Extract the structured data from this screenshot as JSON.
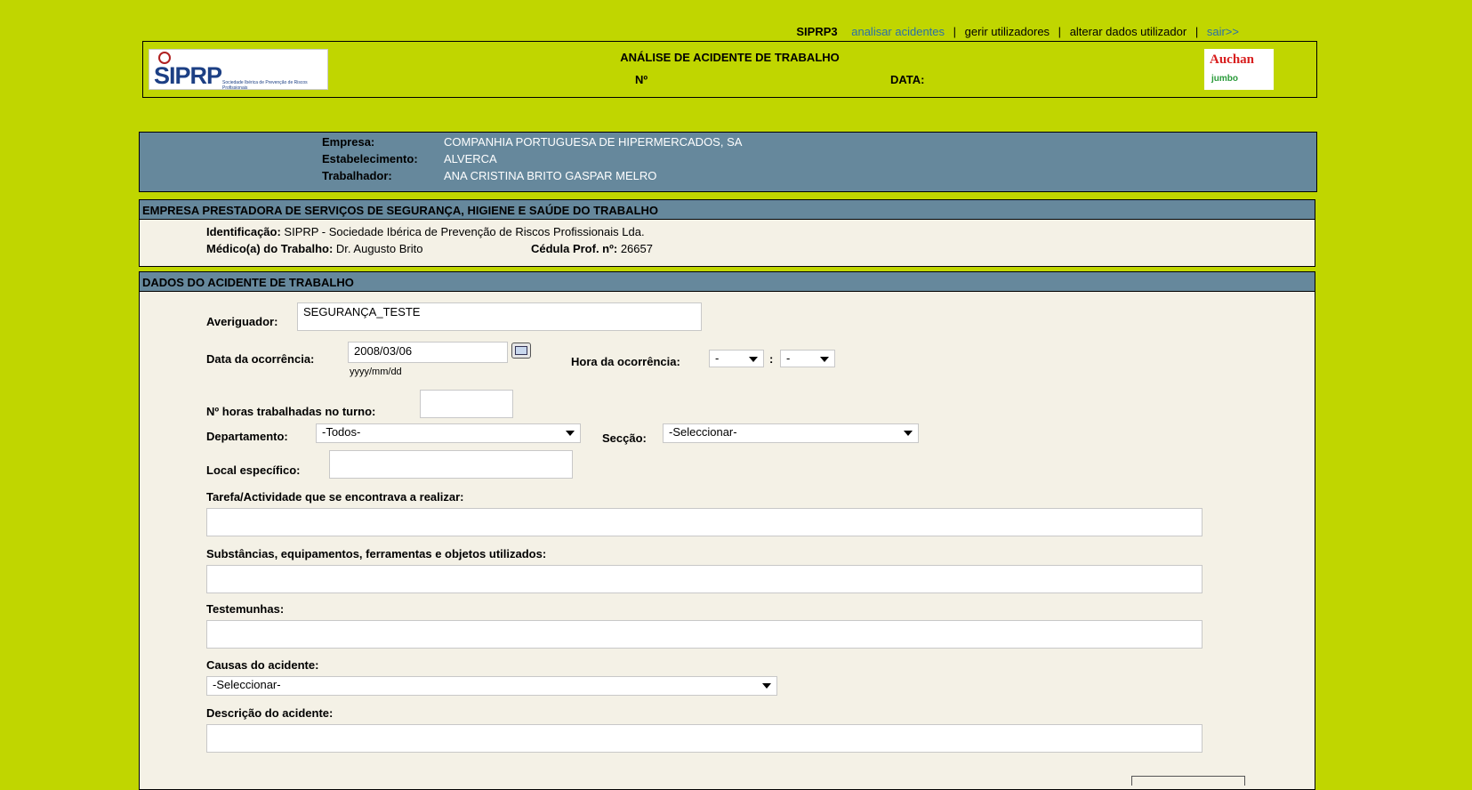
{
  "topnav": {
    "app": "SIPRP3",
    "analisar": "analisar acidentes",
    "sep": "|",
    "gerir": "gerir utilizadores",
    "alterar": "alterar dados utilizador",
    "sair": "sair>>"
  },
  "header": {
    "logo_text": "SIPRP",
    "logo_subtitle": "Sociedade Ibérica de Prevenção de Riscos Profissionais",
    "title": "ANÁLISE DE ACIDENTE DE TRABALHO",
    "n_label": "Nº",
    "data_label": "DATA:",
    "client_logo_top": "Auchan",
    "client_logo_bottom": "jumbo"
  },
  "info": {
    "empresa_label": "Empresa:",
    "empresa_value": "COMPANHIA PORTUGUESA DE HIPERMERCADOS, SA",
    "estabelecimento_label": "Estabelecimento:",
    "estabelecimento_value": "ALVERCA",
    "trabalhador_label": "Trabalhador:",
    "trabalhador_value": "ANA CRISTINA BRITO GASPAR MELRO"
  },
  "prestadora": {
    "title": "EMPRESA PRESTADORA DE SERVIÇOS DE SEGURANÇA, HIGIENE E SAÚDE DO TRABALHO",
    "identificacao_label": "Identificação:",
    "identificacao_value": "SIPRP - Sociedade Ibérica de Prevenção de Riscos Profissionais Lda.",
    "medico_label": "Médico(a) do Trabalho:",
    "medico_value": "Dr. Augusto Brito",
    "cedula_label": "Cédula Prof. nº:",
    "cedula_value": "26657"
  },
  "acidente": {
    "title": "DADOS DO ACIDENTE DE TRABALHO",
    "averiguador_label": "Averiguador:",
    "averiguador_value": "SEGURANÇA_TESTE",
    "data_label": "Data da ocorrência:",
    "data_value": "2008/03/06",
    "data_hint": "yyyy/mm/dd",
    "hora_label": "Hora da ocorrência:",
    "hora_value": "-",
    "hora_sep": ":",
    "minuto_value": "-",
    "horas_turno_label": "Nº horas trabalhadas no turno:",
    "horas_turno_value": "",
    "departamento_label": "Departamento:",
    "departamento_value": "-Todos-",
    "seccao_label": "Secção:",
    "seccao_value": "-Seleccionar-",
    "local_label": "Local específico:",
    "local_value": "",
    "tarefa_label": "Tarefa/Actividade que se encontrava a realizar:",
    "tarefa_value": "",
    "substancias_label": "Substâncias, equipamentos, ferramentas e objetos utilizados:",
    "substancias_value": "",
    "testemunhas_label": "Testemunhas:",
    "testemunhas_value": "",
    "causas_label": "Causas do acidente:",
    "causas_value": "-Seleccionar-",
    "descricao_label": "Descrição do acidente:",
    "descricao_value": ""
  }
}
